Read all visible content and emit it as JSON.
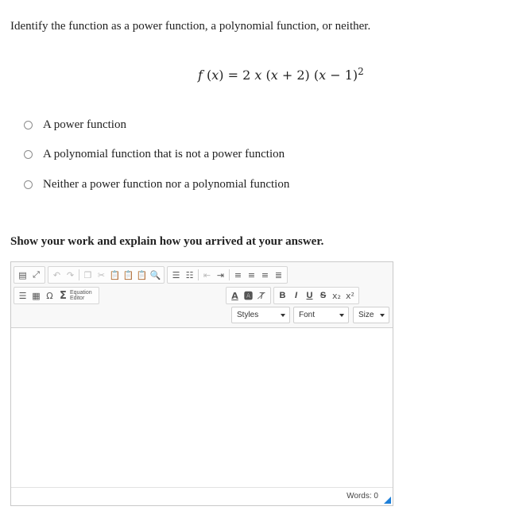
{
  "question": {
    "prompt": "Identify the function as a power function, a polynomial function, or neither.",
    "formula": {
      "f": "f",
      "open": " (",
      "x1": "x",
      "eq": ") = 2 ",
      "x2": "x",
      "p1": " (",
      "x3": "x",
      "p2": " + 2) (",
      "x4": "x",
      "p3": " − 1)",
      "exp": "2"
    }
  },
  "options": [
    "A power function",
    "A polynomial function that is not a power function",
    "Neither a power function nor a polynomial function"
  ],
  "work_prompt": "Show your work and explain how you arrived at your answer.",
  "editor": {
    "equation_editor": [
      "Equation",
      "Editor"
    ],
    "format_buttons": [
      "B",
      "I",
      "U",
      "S"
    ],
    "styles_label": "Styles",
    "font_label": "Font",
    "size_label": "Size",
    "words_label": "Words: 0",
    "accent_color": "#1e7fd8"
  }
}
